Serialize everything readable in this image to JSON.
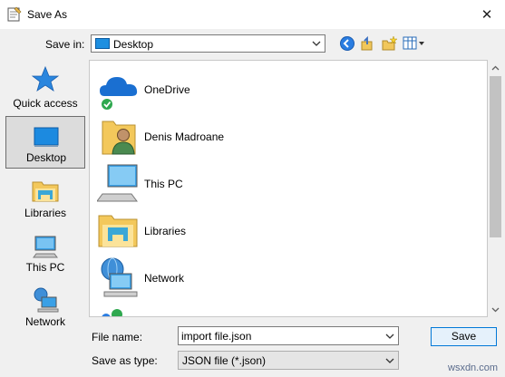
{
  "window": {
    "title": "Save As",
    "close_glyph": "✕"
  },
  "save_in": {
    "label": "Save in:",
    "value": "Desktop"
  },
  "places": [
    {
      "label": "Quick access",
      "icon": "star-icon"
    },
    {
      "label": "Desktop",
      "icon": "desktop-icon",
      "selected": true
    },
    {
      "label": "Libraries",
      "icon": "libraries-icon"
    },
    {
      "label": "This PC",
      "icon": "this-pc-icon"
    },
    {
      "label": "Network",
      "icon": "network-icon"
    }
  ],
  "items": [
    {
      "label": "OneDrive",
      "icon": "onedrive-icon"
    },
    {
      "label": "Denis Madroane",
      "icon": "user-folder-icon"
    },
    {
      "label": "This PC",
      "icon": "this-pc-icon"
    },
    {
      "label": "Libraries",
      "icon": "libraries-icon"
    },
    {
      "label": "Network",
      "icon": "network-icon"
    }
  ],
  "file_name": {
    "label": "File name:",
    "value": "import file.json"
  },
  "save_as_type": {
    "label": "Save as type:",
    "value": "JSON file (*.json)"
  },
  "buttons": {
    "save": "Save"
  },
  "watermark": "wsxdn.com",
  "colors": {
    "selection": "#dcdcdc",
    "accent": "#0078d7"
  }
}
